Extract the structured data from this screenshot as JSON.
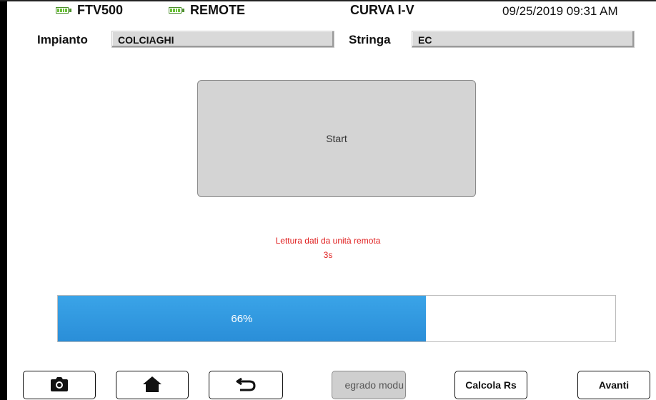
{
  "status_bar": {
    "device_name": "FTV500",
    "remote_label": "REMOTE",
    "screen_title": "CURVA I-V",
    "datetime": "09/25/2019 09:31 AM"
  },
  "fields": {
    "impianto_label": "Impianto",
    "impianto_value": "COLCIAGHI",
    "stringa_label": "Stringa",
    "stringa_value": "EC"
  },
  "main": {
    "start_label": "Start",
    "status_message": "Lettura dati da unità remota",
    "countdown": "3s",
    "progress_percent": 66,
    "progress_text": "66%"
  },
  "toolbar": {
    "camera_icon": "camera-icon",
    "home_icon": "home-icon",
    "back_icon": "back-arrow-icon",
    "degrado_label": "egrado modu",
    "calcola_label": "Calcola Rs",
    "avanti_label": "Avanti"
  },
  "colors": {
    "battery": "#6cc13a",
    "progress_fill": "#2a8ed8",
    "status_text": "#e02020",
    "field_bg": "#d9d9d9"
  }
}
